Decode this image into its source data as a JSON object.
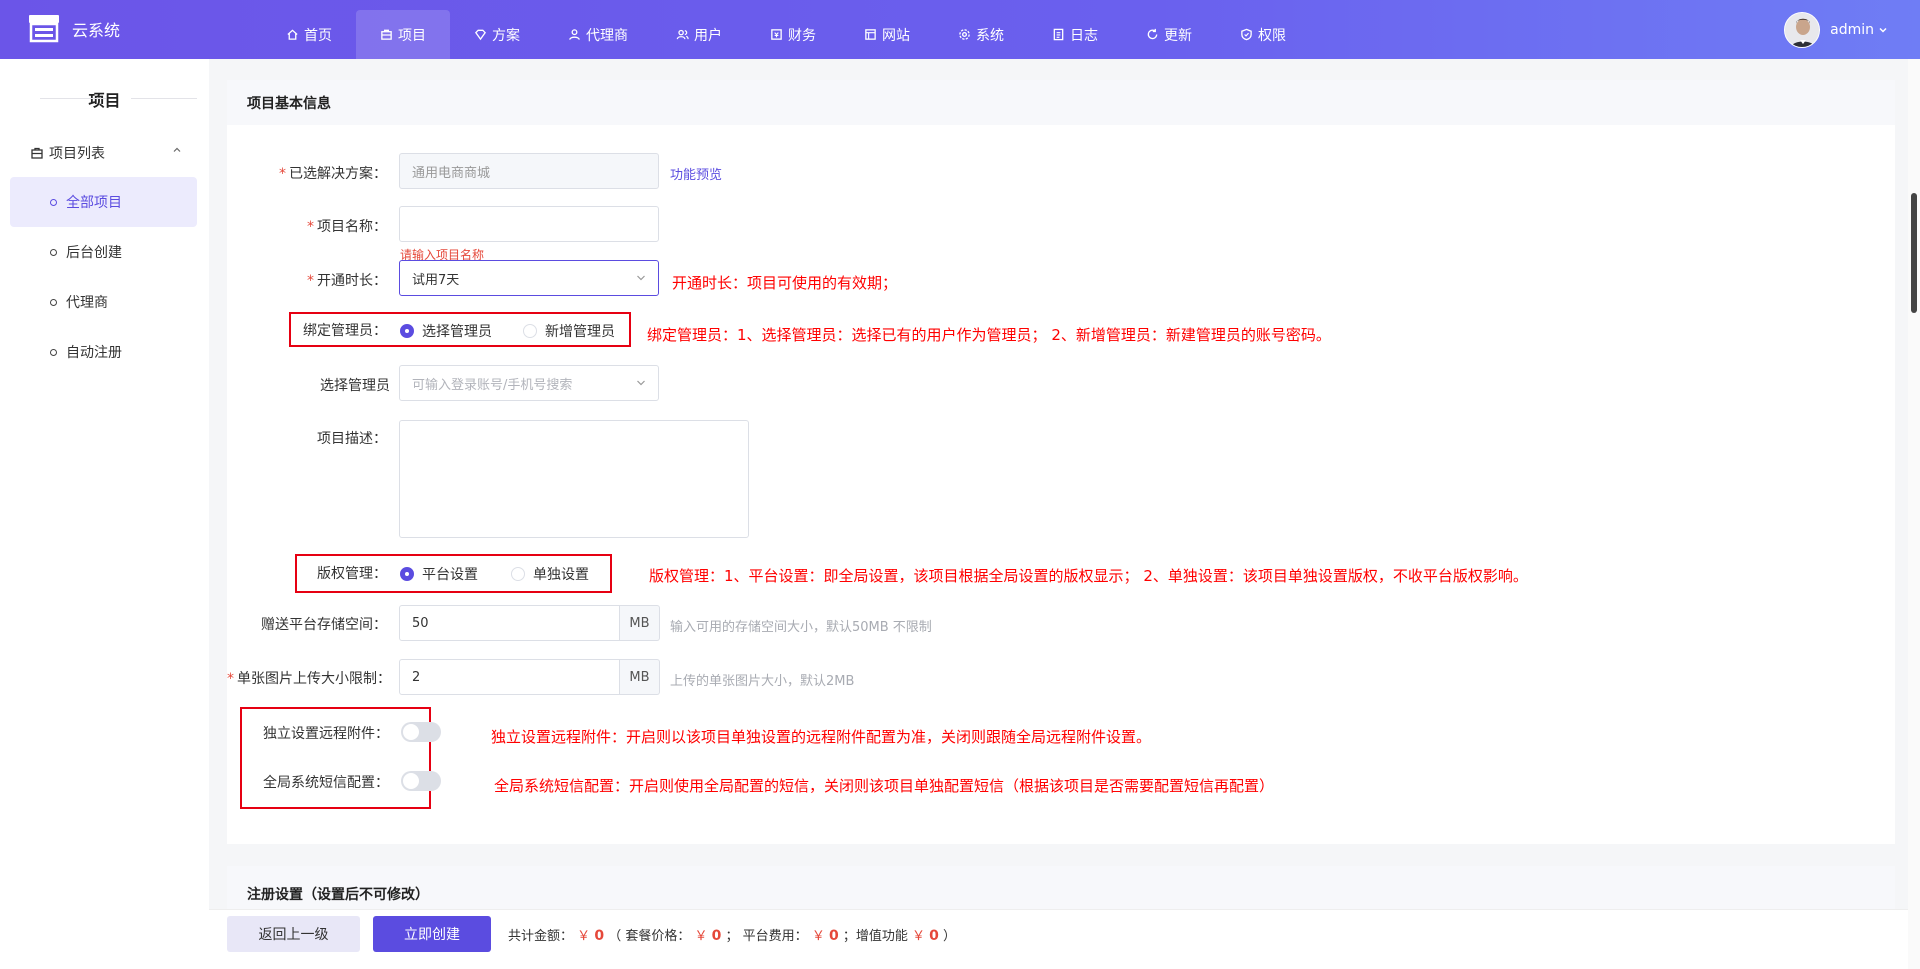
{
  "app": {
    "name": "云系统",
    "username": "admin"
  },
  "nav": [
    {
      "label": "首页",
      "icon": "home-icon"
    },
    {
      "label": "项目",
      "icon": "box-icon",
      "active": true
    },
    {
      "label": "方案",
      "icon": "diamond-icon"
    },
    {
      "label": "代理商",
      "icon": "agent-icon"
    },
    {
      "label": "用户",
      "icon": "users-icon"
    },
    {
      "label": "财务",
      "icon": "finance-icon"
    },
    {
      "label": "网站",
      "icon": "website-icon"
    },
    {
      "label": "系统",
      "icon": "gear-icon"
    },
    {
      "label": "日志",
      "icon": "log-icon"
    },
    {
      "label": "更新",
      "icon": "refresh-icon"
    },
    {
      "label": "权限",
      "icon": "shield-icon"
    }
  ],
  "sidebar": {
    "title": "项目",
    "group": "项目列表",
    "items": [
      {
        "label": "全部项目",
        "active": true
      },
      {
        "label": "后台创建"
      },
      {
        "label": "代理商"
      },
      {
        "label": "自动注册"
      }
    ]
  },
  "form": {
    "section_title": "项目基本信息",
    "solution_label": "已选解决方案：",
    "solution_value": "通用电商商城",
    "preview_link": "功能预览",
    "name_label": "项目名称：",
    "name_error": "请输入项目名称",
    "duration_label": "开通时长：",
    "duration_value": "试用7天",
    "bind_admin_label": "绑定管理员：",
    "bind_admin_options": [
      "选择管理员",
      "新增管理员"
    ],
    "select_admin_label": "选择管理员",
    "select_admin_placeholder": "可输入登录账号/手机号搜索",
    "desc_label": "项目描述：",
    "copyright_label": "版权管理：",
    "copyright_options": [
      "平台设置",
      "单独设置"
    ],
    "storage_label": "赠送平台存储空间：",
    "storage_value": "50",
    "storage_unit": "MB",
    "storage_hint": "输入可用的存储空间大小，默认50MB 不限制",
    "image_label": "单张图片上传大小限制：",
    "image_value": "2",
    "image_unit": "MB",
    "image_hint": "上传的单张图片大小，默认2MB",
    "remote_label": "独立设置远程附件：",
    "sms_label": "全局系统短信配置："
  },
  "annotations": {
    "duration": "开通时长：项目可使用的有效期；",
    "bind_admin": "绑定管理员：1、选择管理员：选择已有的用户作为管理员；  2、新增管理员：新建管理员的账号密码。",
    "copyright": "版权管理：1、平台设置：即全局设置，该项目根据全局设置的版权显示；  2、单独设置：该项目单独设置版权，不收平台版权影响。",
    "remote": "独立设置远程附件：开启则以该项目单独设置的远程附件配置为准，关闭则跟随全局远程附件设置。",
    "sms": "全局系统短信配置：开启则使用全局配置的短信，关闭则该项目单独配置短信（根据该项目是否需要配置短信再配置）"
  },
  "register_section_title": "注册设置（设置后不可修改）",
  "footer": {
    "back": "返回上一级",
    "create": "立即创建",
    "total_label": "共计金额：",
    "currency": "￥",
    "total": "0",
    "package_label": "套餐价格：",
    "package": "0",
    "platform_label": "平台费用：",
    "platform": "0",
    "addon_label": "增值功能",
    "addon": "0"
  },
  "colors": {
    "accent": "#5b4ce0",
    "annotation": "#ff0000",
    "error": "#e5483a"
  }
}
